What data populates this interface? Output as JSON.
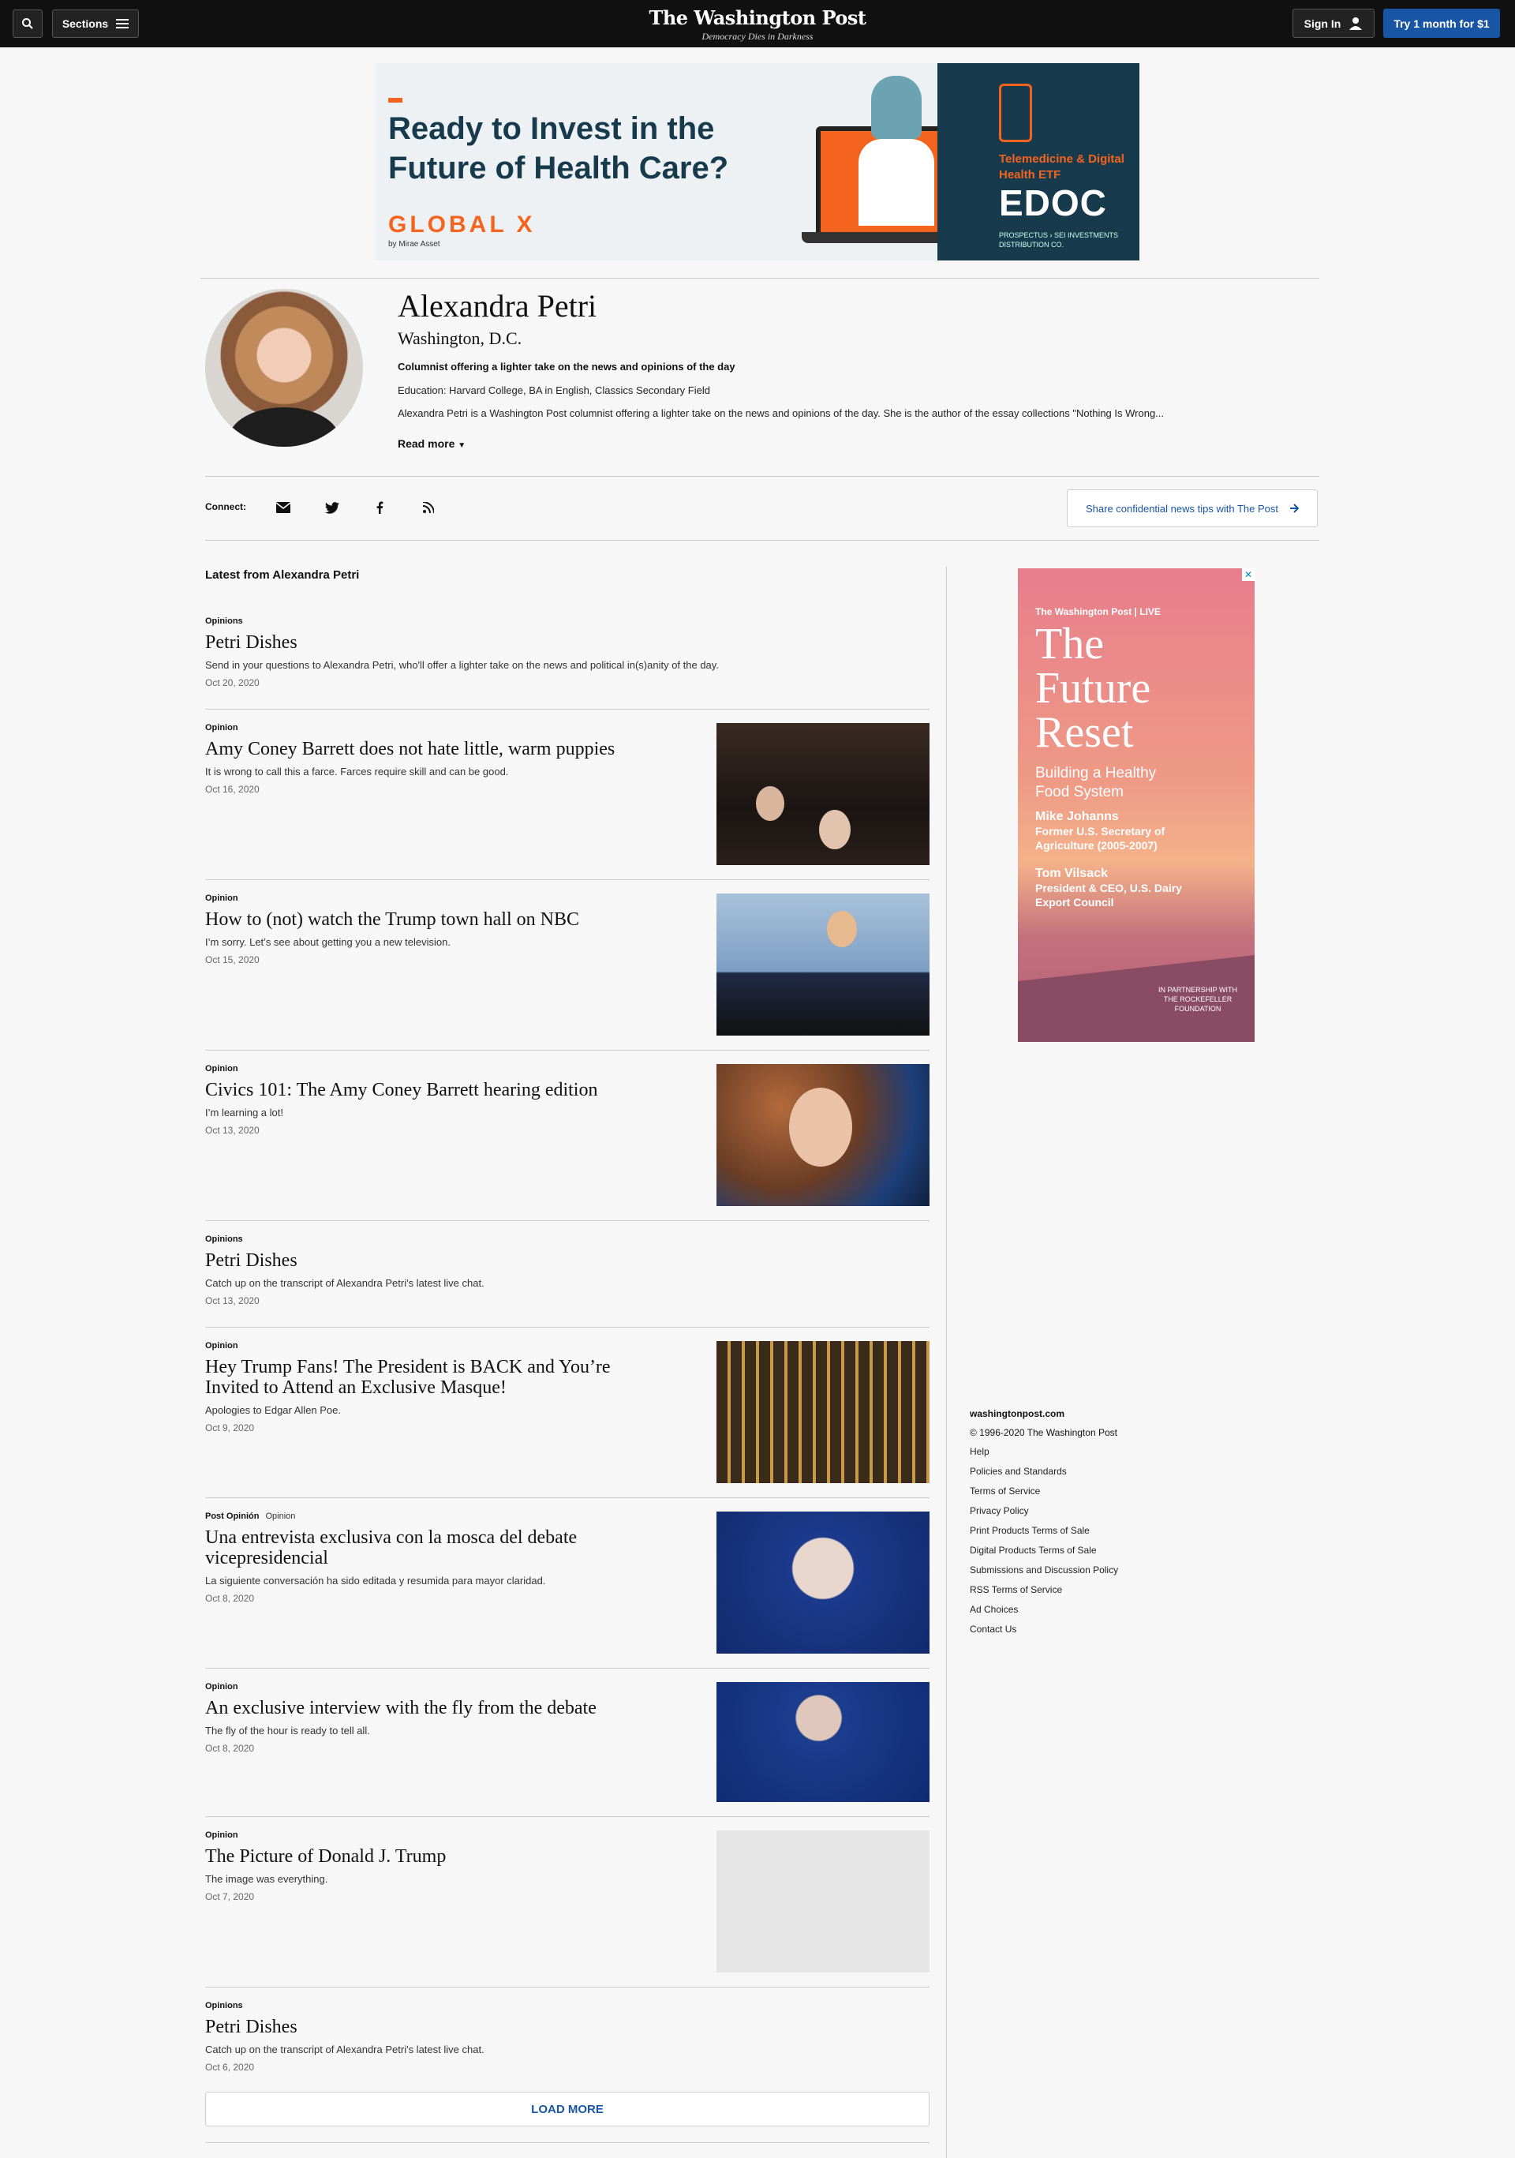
{
  "nav": {
    "sections_label": "Sections",
    "logo": "The Washington Post",
    "tagline": "Democracy Dies in Darkness",
    "signin_label": "Sign In",
    "try_label": "Try 1 month for $1"
  },
  "top_ad": {
    "headline": "Ready to Invest in the Future of Health Care?",
    "brand": "GLOBAL X",
    "brand_sub": "by Mirae Asset",
    "product_line": "Telemedicine & Digital Health ETF",
    "ticker": "EDOC",
    "disclaimer": "PROSPECTUS › SEI INVESTMENTS DISTRIBUTION CO."
  },
  "author": {
    "name": "Alexandra Petri",
    "location": "Washington, D.C.",
    "tagline": "Columnist offering a lighter take on the news and opinions of the day",
    "education": "Education: Harvard College, BA in English, Classics Secondary Field",
    "bio": "Alexandra Petri is a Washington Post columnist offering a lighter take on the news and opinions of the day. She is the author of the essay collections \"Nothing Is Wrong...",
    "read_more": "Read more"
  },
  "connect": {
    "label": "Connect:",
    "icons": [
      "mail-icon",
      "twitter-icon",
      "facebook-icon",
      "rss-icon"
    ],
    "share_tips": "Share confidential news tips with The Post"
  },
  "latest_label": "Latest from Alexandra Petri",
  "articles": [
    {
      "kicker": "Opinions",
      "kicker_sub": "",
      "title": "Petri Dishes",
      "blurb": "Send in your questions to Alexandra Petri, who'll offer a lighter take on the news and political in(s)anity of the day.",
      "date": "Oct 20, 2020"
    },
    {
      "kicker": "Opinion",
      "kicker_sub": "",
      "title": "Amy Coney Barrett does not hate little, warm puppies",
      "blurb": "It is wrong to call this a farce. Farces require skill and can be good.",
      "date": "Oct 16, 2020"
    },
    {
      "kicker": "Opinion",
      "kicker_sub": "",
      "title": "How to (not) watch the Trump town hall on NBC",
      "blurb": "I’m sorry. Let’s see about getting you a new television.",
      "date": "Oct 15, 2020"
    },
    {
      "kicker": "Opinion",
      "kicker_sub": "",
      "title": "Civics 101: The Amy Coney Barrett hearing edition",
      "blurb": "I’m learning a lot!",
      "date": "Oct 13, 2020"
    },
    {
      "kicker": "Opinions",
      "kicker_sub": "",
      "title": "Petri Dishes",
      "blurb": "Catch up on the transcript of Alexandra Petri's latest live chat.",
      "date": "Oct 13, 2020"
    },
    {
      "kicker": "Opinion",
      "kicker_sub": "",
      "title": "Hey Trump Fans! The President is BACK and You’re Invited to Attend an Exclusive Masque!",
      "blurb": "Apologies to Edgar Allen Poe.",
      "date": "Oct 9, 2020"
    },
    {
      "kicker": "Post Opinión",
      "kicker_sub": "Opinion",
      "title": "Una entrevista exclusiva con la mosca del debate vicepresidencial",
      "blurb": "La siguiente conversación ha sido editada y resumida para mayor claridad.",
      "date": "Oct 8, 2020"
    },
    {
      "kicker": "Opinion",
      "kicker_sub": "",
      "title": "An exclusive interview with the fly from the debate",
      "blurb": "The fly of the hour is ready to tell all.",
      "date": "Oct 8, 2020"
    },
    {
      "kicker": "Opinion",
      "kicker_sub": "",
      "title": "The Picture of Donald J. Trump",
      "blurb": "The image was everything.",
      "date": "Oct 7, 2020"
    },
    {
      "kicker": "Opinions",
      "kicker_sub": "",
      "title": "Petri Dishes",
      "blurb": "Catch up on the transcript of Alexandra Petri's latest live chat.",
      "date": "Oct 6, 2020"
    }
  ],
  "load_more": "LOAD MORE",
  "side_ad": {
    "live": "The Washington Post | LIVE",
    "headline": "The Future Reset",
    "sub": "Building a Healthy Food System",
    "person1": "Mike Johanns",
    "person1_title": "Former U.S. Secretary of Agriculture (2005-2007)",
    "person2": "Tom Vilsack",
    "person2_title": "President & CEO, U.S. Dairy Export Council",
    "partner": "IN PARTNERSHIP WITH THE ROCKEFELLER FOUNDATION"
  },
  "footer": {
    "site": "washingtonpost.com",
    "copyright": "© 1996-2020 The Washington Post",
    "links": [
      "Help",
      "Policies and Standards",
      "Terms of Service",
      "Privacy Policy",
      "Print Products Terms of Sale",
      "Digital Products Terms of Sale",
      "Submissions and Discussion Policy",
      "RSS Terms of Service",
      "Ad Choices",
      "Contact Us"
    ]
  },
  "colors": {
    "accent": "#1955a5",
    "nav_bg": "#111111",
    "page_bg": "#f7f7f7"
  }
}
